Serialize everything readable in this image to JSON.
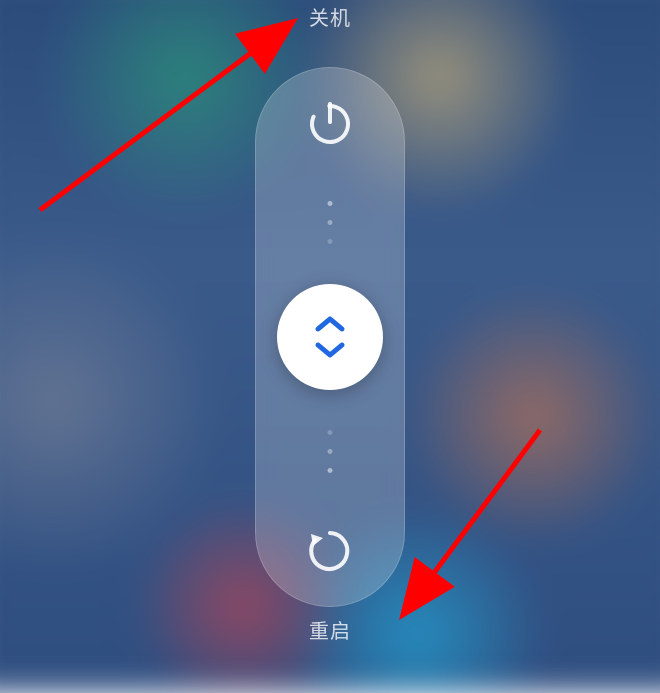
{
  "power_menu": {
    "shutdown_label": "关机",
    "restart_label": "重启",
    "accent_color": "#2067e0",
    "icons": {
      "power": "power-icon",
      "restart": "restart-icon",
      "handle": "drag-handle-icon"
    }
  },
  "annotation": {
    "arrow_color": "#ff0000"
  }
}
